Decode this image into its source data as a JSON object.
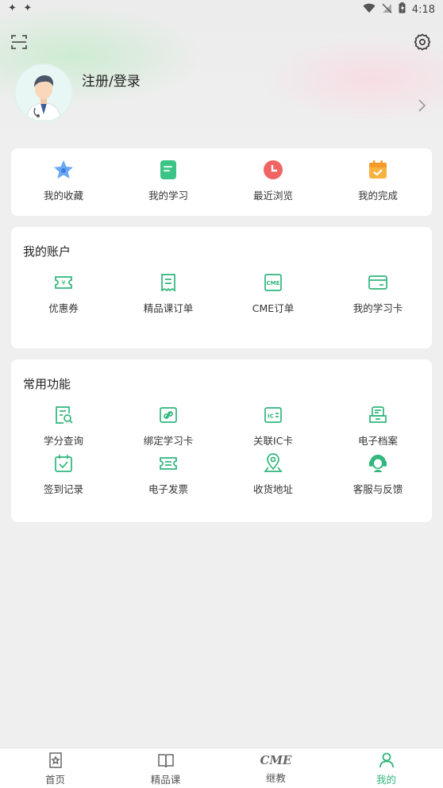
{
  "status_bar": {
    "left_icons": "✦ ✦",
    "time": "4:18"
  },
  "profile": {
    "login_label": "注册/登录"
  },
  "quick": [
    {
      "label": "我的收藏",
      "icon": "star-icon"
    },
    {
      "label": "我的学习",
      "icon": "document-icon"
    },
    {
      "label": "最近浏览",
      "icon": "clock-icon"
    },
    {
      "label": "我的完成",
      "icon": "calendar-check-icon"
    }
  ],
  "account": {
    "title": "我的账户",
    "items": [
      {
        "label": "优惠券",
        "icon": "coupon-icon"
      },
      {
        "label": "精品课订单",
        "icon": "receipt-icon"
      },
      {
        "label": "CME订单",
        "icon": "cme-order-icon"
      },
      {
        "label": "我的学习卡",
        "icon": "card-icon"
      }
    ]
  },
  "functions": {
    "title": "常用功能",
    "items": [
      {
        "label": "学分查询",
        "icon": "credit-search-icon"
      },
      {
        "label": "绑定学习卡",
        "icon": "link-card-icon"
      },
      {
        "label": "关联IC卡",
        "icon": "ic-card-icon"
      },
      {
        "label": "电子档案",
        "icon": "archive-icon"
      },
      {
        "label": "签到记录",
        "icon": "checkin-icon"
      },
      {
        "label": "电子发票",
        "icon": "invoice-icon"
      },
      {
        "label": "收货地址",
        "icon": "location-icon"
      },
      {
        "label": "客服与反馈",
        "icon": "headset-icon"
      }
    ]
  },
  "bottom_nav": [
    {
      "label": "首页",
      "icon": "home-icon"
    },
    {
      "label": "精品课",
      "icon": "book-icon"
    },
    {
      "label": "继教",
      "icon": "cme-icon",
      "icon_text": "CME"
    },
    {
      "label": "我的",
      "icon": "person-icon",
      "active": true
    }
  ],
  "colors": {
    "accent": "#2fb67c",
    "background": "#efefef"
  }
}
